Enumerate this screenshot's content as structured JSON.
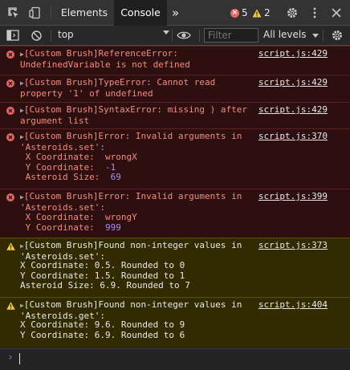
{
  "tabs": [
    {
      "label": "Elements"
    },
    {
      "label": "Console",
      "active": true
    }
  ],
  "more_tabs": "»",
  "error_count": "5",
  "warning_count": "2",
  "context": "top",
  "filter_placeholder": "Filter",
  "levels_label": "All levels",
  "colors": {
    "error_bg": "#2e0f0f",
    "error_text": "#f28b82",
    "warn_bg": "#332b00",
    "warn_icon": "#f2c744",
    "link": "#e8e8e8"
  },
  "messages": [
    {
      "level": "error",
      "lines": [
        "[Custom Brush]ReferenceError:",
        "UndefinedVariable is not defined"
      ],
      "source": "script.js:429"
    },
    {
      "level": "error",
      "lines": [
        "[Custom Brush]TypeError: Cannot read",
        "property '1' of undefined"
      ],
      "source": "script.js:429"
    },
    {
      "level": "error",
      "lines": [
        "[Custom Brush]SyntaxError: missing ) after",
        "argument list"
      ],
      "source": "script.js:429"
    },
    {
      "level": "error",
      "lines": [
        "[Custom Brush]Error: Invalid arguments in",
        "'Asteroids.set':"
      ],
      "source": "script.js:370",
      "fields": [
        {
          "label": " X Coordinate:",
          "value": "wrongX",
          "kind": "str"
        },
        {
          "label": " Y Coordinate:",
          "value": "-1",
          "kind": "num"
        },
        {
          "label": " Asteroid Size:",
          "value": "69",
          "kind": "num"
        }
      ]
    },
    {
      "level": "error",
      "lines": [
        "[Custom Brush]Error: Invalid arguments in",
        "'Asteroids.set':"
      ],
      "source": "script.js:399",
      "fields": [
        {
          "label": " X Coordinate:",
          "value": "wrongY",
          "kind": "str"
        },
        {
          "label": " Y Coordinate:",
          "value": "999",
          "kind": "num"
        }
      ]
    },
    {
      "level": "warn",
      "lines": [
        "[Custom Brush]Found non-integer values in",
        "'Asteroids.set':",
        "X Coordinate: 0.5. Rounded to 0",
        "Y Coordinate: 1.5. Rounded to 1",
        "Asteroid Size: 6.9. Rounded to 7"
      ],
      "source": "script.js:373"
    },
    {
      "level": "warn",
      "lines": [
        "[Custom Brush]Found non-integer values in",
        "'Asteroids.get':",
        "X Coordinate: 9.6. Rounded to 9",
        "Y Coordinate: 6.9. Rounded to 6"
      ],
      "source": "script.js:404"
    }
  ],
  "prompt_symbol": "›"
}
